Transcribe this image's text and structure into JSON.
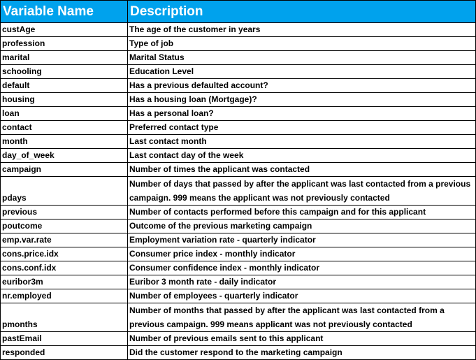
{
  "table": {
    "headers": [
      "Variable Name",
      "Description"
    ],
    "rows": [
      {
        "name": "custAge",
        "desc": "The age of the customer in years"
      },
      {
        "name": "profession",
        "desc": "Type of job"
      },
      {
        "name": "marital",
        "desc": "Marital Status"
      },
      {
        "name": "schooling",
        "desc": "Education Level"
      },
      {
        "name": "default",
        "desc": "Has a previous defaulted account?"
      },
      {
        "name": "housing",
        "desc": "Has a housing loan (Mortgage)?"
      },
      {
        "name": "loan",
        "desc": "Has a personal loan?"
      },
      {
        "name": "contact",
        "desc": "Preferred contact type"
      },
      {
        "name": "month",
        "desc": "Last contact month"
      },
      {
        "name": "day_of_week",
        "desc": "Last contact day of the week"
      },
      {
        "name": "campaign",
        "desc": "Number of times the applicant was contacted"
      },
      {
        "name": "pdays",
        "desc": "Number of days that passed by after the applicant was last contacted from a previous campaign. 999 means the applicant was not previously contacted",
        "tall": true
      },
      {
        "name": "previous",
        "desc": "Number of contacts performed before this campaign and for this applicant"
      },
      {
        "name": "poutcome",
        "desc": "Outcome of the previous marketing campaign"
      },
      {
        "name": "emp.var.rate",
        "desc": "Employment variation rate - quarterly indicator"
      },
      {
        "name": "cons.price.idx",
        "desc": "Consumer price index - monthly indicator"
      },
      {
        "name": "cons.conf.idx",
        "desc": "Consumer confidence index - monthly indicator"
      },
      {
        "name": "euribor3m",
        "desc": "Euribor 3 month rate - daily indicator"
      },
      {
        "name": "nr.employed",
        "desc": "Number of employees - quarterly indicator"
      },
      {
        "name": "pmonths",
        "desc": "Number of months that passed by after the applicant was last contacted from a previous campaign. 999 means applicant was not previously contacted",
        "tall": true
      },
      {
        "name": "pastEmail",
        "desc": "Number of previous emails sent to this applicant"
      },
      {
        "name": "responded",
        "desc": "Did the customer respond to the marketing campaign"
      }
    ]
  }
}
